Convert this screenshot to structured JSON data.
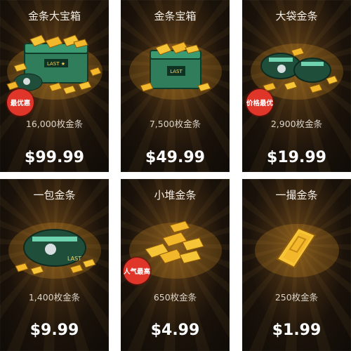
{
  "store": {
    "items": [
      {
        "name": "金条大宝箱",
        "quantity": "16,000枚金条",
        "price": "$99.99",
        "badge": "最优惠"
      },
      {
        "name": "金条宝箱",
        "quantity": "7,500枚金条",
        "price": "$49.99",
        "badge": ""
      },
      {
        "name": "大袋金条",
        "quantity": "2,900枚金条",
        "price": "$19.99",
        "badge": "价格最优"
      },
      {
        "name": "一包金条",
        "quantity": "1,400枚金条",
        "price": "$9.99",
        "badge": ""
      },
      {
        "name": "小堆金条",
        "quantity": "650枚金条",
        "price": "$4.99",
        "badge": "人气最高"
      },
      {
        "name": "一撮金条",
        "quantity": "250枚金条",
        "price": "$1.99",
        "badge": ""
      }
    ],
    "colors": {
      "card_bg": "#1a120a",
      "gold": "#f2b72a",
      "crate_green": "#2f7d5a",
      "badge_red": "#e0362a"
    }
  }
}
